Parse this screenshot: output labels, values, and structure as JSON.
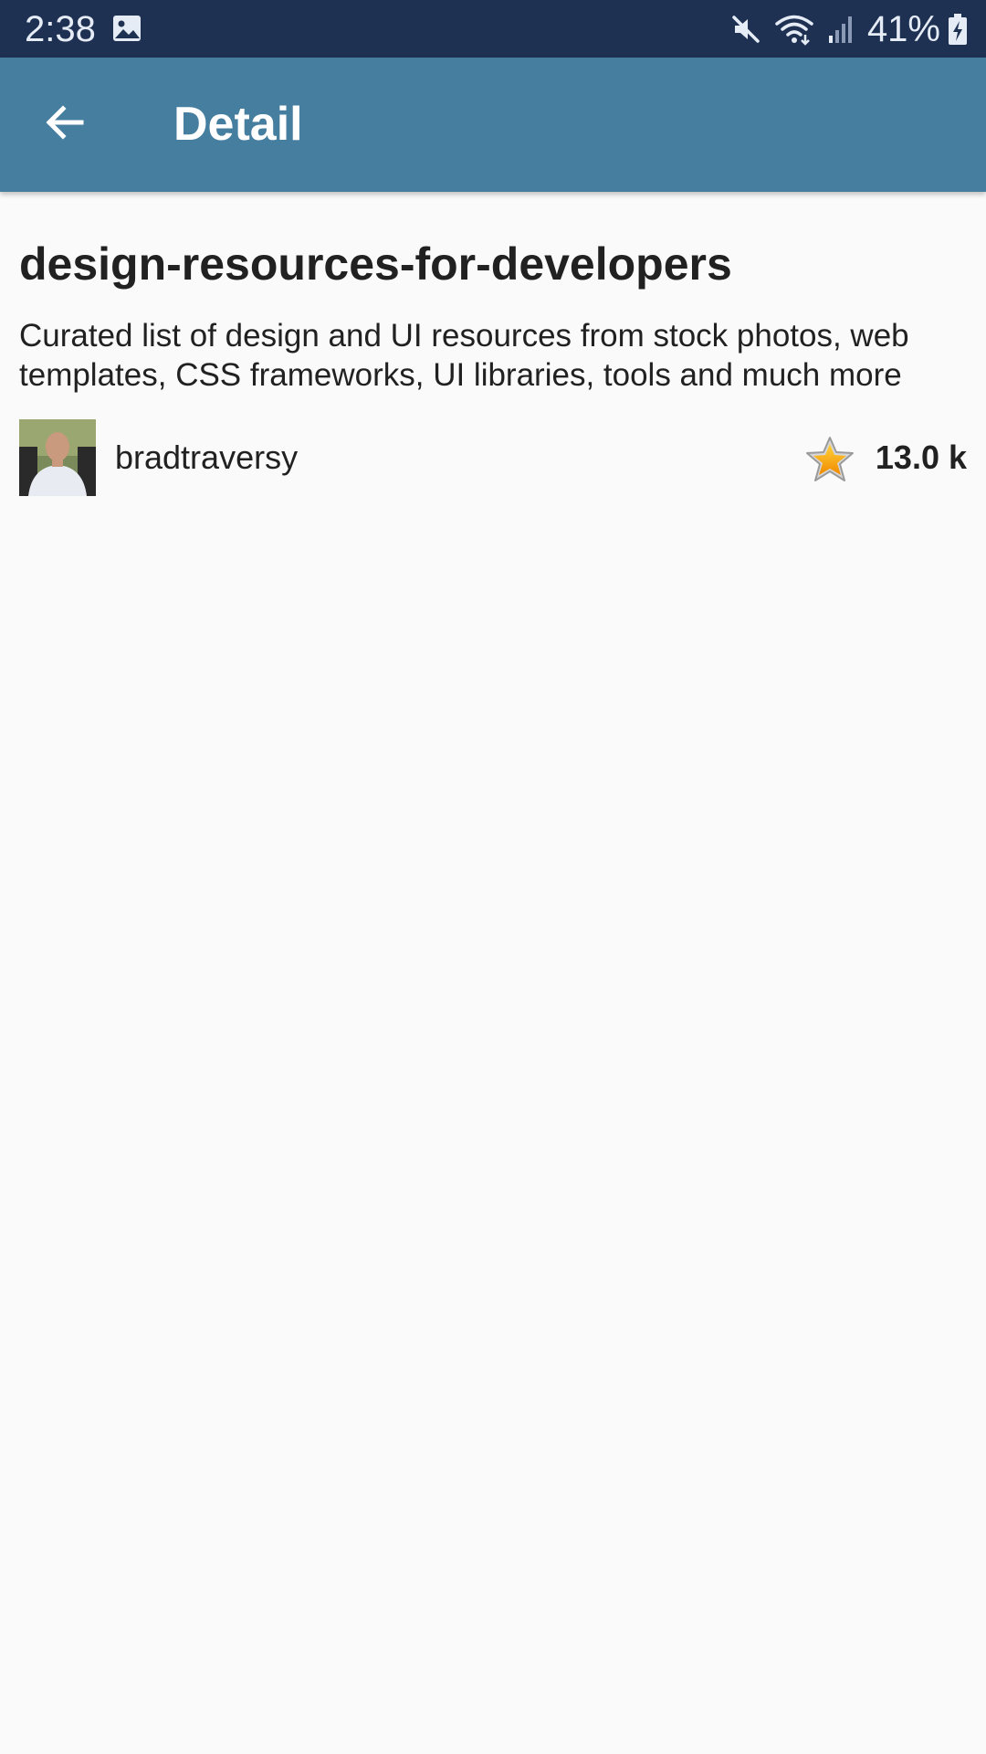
{
  "status_bar": {
    "time": "2:38",
    "battery": "41%",
    "icons": [
      "gallery-icon",
      "mute-icon",
      "wifi-icon",
      "signal-icon",
      "battery-charging-icon"
    ]
  },
  "app_bar": {
    "title": "Detail",
    "back_icon": "arrow-back-icon",
    "background_color": "#467e9f"
  },
  "repo": {
    "name": "design-resources-for-developers",
    "description": "Curated list of design and UI resources from stock photos, web templates, CSS frameworks, UI libraries, tools and much more",
    "owner": "bradtraversy",
    "stars": "13.0 k",
    "star_icon": "star-icon",
    "avatar_icon": "avatar"
  }
}
